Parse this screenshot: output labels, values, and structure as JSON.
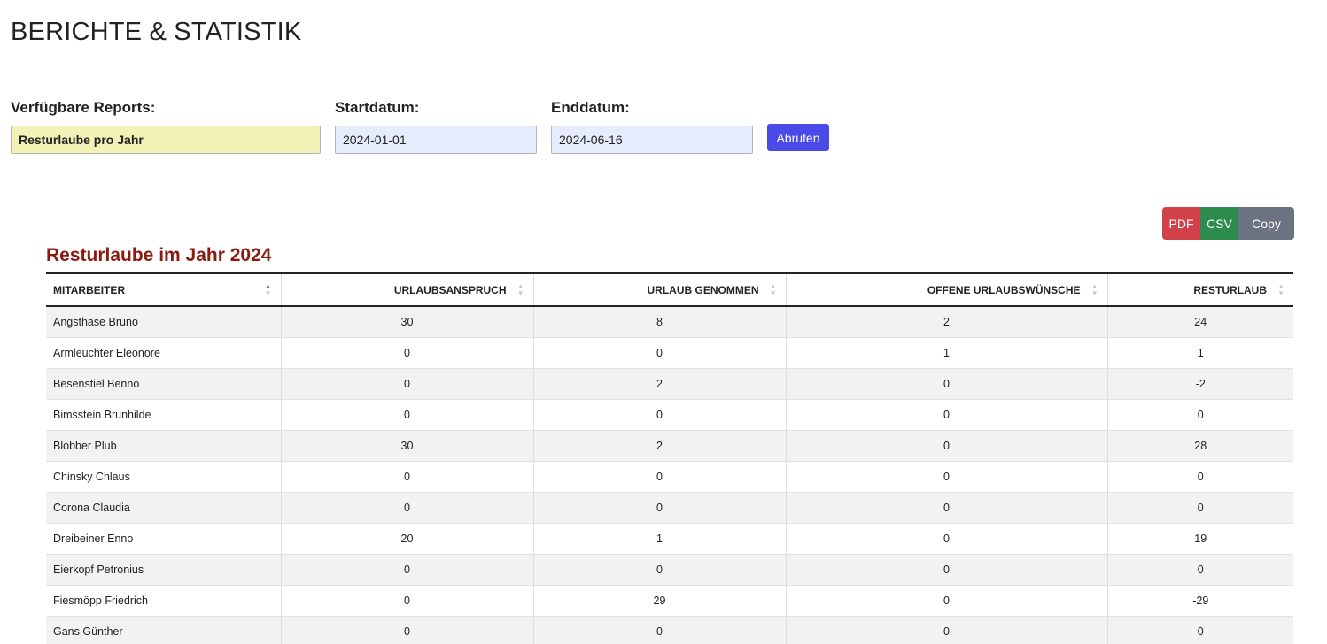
{
  "page": {
    "title": "BERICHTE & STATISTIK"
  },
  "filters": {
    "report_label": "Verfügbare Reports:",
    "report_value": "Resturlaube pro Jahr",
    "start_label": "Startdatum:",
    "start_value": "2024-01-01",
    "end_label": "Enddatum:",
    "end_value": "2024-06-16",
    "submit_label": "Abrufen"
  },
  "export": {
    "pdf": "PDF",
    "csv": "CSV",
    "copy": "Copy"
  },
  "report": {
    "title": "Resturlaube im Jahr 2024",
    "columns": [
      "MITARBEITER",
      "URLAUBSANSPRUCH",
      "URLAUB GENOMMEN",
      "OFFENE URLAUBSWÜNSCHE",
      "RESTURLAUB"
    ],
    "rows": [
      [
        "Angsthase Bruno",
        "30",
        "8",
        "2",
        "24"
      ],
      [
        "Armleuchter Eleonore",
        "0",
        "0",
        "1",
        "1"
      ],
      [
        "Besenstiel Benno",
        "0",
        "2",
        "0",
        "-2"
      ],
      [
        "Bimsstein Brunhilde",
        "0",
        "0",
        "0",
        "0"
      ],
      [
        "Blobber Plub",
        "30",
        "2",
        "0",
        "28"
      ],
      [
        "Chinsky Chlaus",
        "0",
        "0",
        "0",
        "0"
      ],
      [
        "Corona Claudia",
        "0",
        "0",
        "0",
        "0"
      ],
      [
        "Dreibeiner Enno",
        "20",
        "1",
        "0",
        "19"
      ],
      [
        "Eierkopf Petronius",
        "0",
        "0",
        "0",
        "0"
      ],
      [
        "Fiesmöpp Friedrich",
        "0",
        "29",
        "0",
        "-29"
      ],
      [
        "Gans Günther",
        "0",
        "0",
        "0",
        "0"
      ]
    ]
  },
  "colors": {
    "accent": "#4a4ae8",
    "title": "#8b1a0e",
    "pdf": "#d1414a",
    "csv": "#2e8b4e",
    "copy": "#6b7280"
  }
}
